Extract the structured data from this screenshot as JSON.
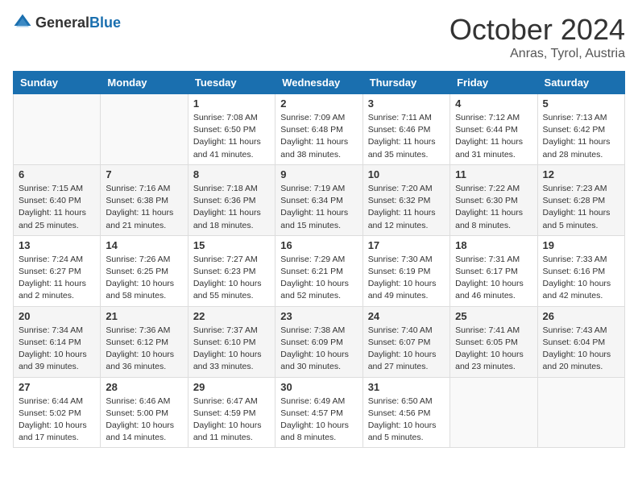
{
  "header": {
    "logo_general": "General",
    "logo_blue": "Blue",
    "month": "October 2024",
    "location": "Anras, Tyrol, Austria"
  },
  "days_of_week": [
    "Sunday",
    "Monday",
    "Tuesday",
    "Wednesday",
    "Thursday",
    "Friday",
    "Saturday"
  ],
  "weeks": [
    [
      {
        "day": "",
        "info": ""
      },
      {
        "day": "",
        "info": ""
      },
      {
        "day": "1",
        "info": "Sunrise: 7:08 AM\nSunset: 6:50 PM\nDaylight: 11 hours and 41 minutes."
      },
      {
        "day": "2",
        "info": "Sunrise: 7:09 AM\nSunset: 6:48 PM\nDaylight: 11 hours and 38 minutes."
      },
      {
        "day": "3",
        "info": "Sunrise: 7:11 AM\nSunset: 6:46 PM\nDaylight: 11 hours and 35 minutes."
      },
      {
        "day": "4",
        "info": "Sunrise: 7:12 AM\nSunset: 6:44 PM\nDaylight: 11 hours and 31 minutes."
      },
      {
        "day": "5",
        "info": "Sunrise: 7:13 AM\nSunset: 6:42 PM\nDaylight: 11 hours and 28 minutes."
      }
    ],
    [
      {
        "day": "6",
        "info": "Sunrise: 7:15 AM\nSunset: 6:40 PM\nDaylight: 11 hours and 25 minutes."
      },
      {
        "day": "7",
        "info": "Sunrise: 7:16 AM\nSunset: 6:38 PM\nDaylight: 11 hours and 21 minutes."
      },
      {
        "day": "8",
        "info": "Sunrise: 7:18 AM\nSunset: 6:36 PM\nDaylight: 11 hours and 18 minutes."
      },
      {
        "day": "9",
        "info": "Sunrise: 7:19 AM\nSunset: 6:34 PM\nDaylight: 11 hours and 15 minutes."
      },
      {
        "day": "10",
        "info": "Sunrise: 7:20 AM\nSunset: 6:32 PM\nDaylight: 11 hours and 12 minutes."
      },
      {
        "day": "11",
        "info": "Sunrise: 7:22 AM\nSunset: 6:30 PM\nDaylight: 11 hours and 8 minutes."
      },
      {
        "day": "12",
        "info": "Sunrise: 7:23 AM\nSunset: 6:28 PM\nDaylight: 11 hours and 5 minutes."
      }
    ],
    [
      {
        "day": "13",
        "info": "Sunrise: 7:24 AM\nSunset: 6:27 PM\nDaylight: 11 hours and 2 minutes."
      },
      {
        "day": "14",
        "info": "Sunrise: 7:26 AM\nSunset: 6:25 PM\nDaylight: 10 hours and 58 minutes."
      },
      {
        "day": "15",
        "info": "Sunrise: 7:27 AM\nSunset: 6:23 PM\nDaylight: 10 hours and 55 minutes."
      },
      {
        "day": "16",
        "info": "Sunrise: 7:29 AM\nSunset: 6:21 PM\nDaylight: 10 hours and 52 minutes."
      },
      {
        "day": "17",
        "info": "Sunrise: 7:30 AM\nSunset: 6:19 PM\nDaylight: 10 hours and 49 minutes."
      },
      {
        "day": "18",
        "info": "Sunrise: 7:31 AM\nSunset: 6:17 PM\nDaylight: 10 hours and 46 minutes."
      },
      {
        "day": "19",
        "info": "Sunrise: 7:33 AM\nSunset: 6:16 PM\nDaylight: 10 hours and 42 minutes."
      }
    ],
    [
      {
        "day": "20",
        "info": "Sunrise: 7:34 AM\nSunset: 6:14 PM\nDaylight: 10 hours and 39 minutes."
      },
      {
        "day": "21",
        "info": "Sunrise: 7:36 AM\nSunset: 6:12 PM\nDaylight: 10 hours and 36 minutes."
      },
      {
        "day": "22",
        "info": "Sunrise: 7:37 AM\nSunset: 6:10 PM\nDaylight: 10 hours and 33 minutes."
      },
      {
        "day": "23",
        "info": "Sunrise: 7:38 AM\nSunset: 6:09 PM\nDaylight: 10 hours and 30 minutes."
      },
      {
        "day": "24",
        "info": "Sunrise: 7:40 AM\nSunset: 6:07 PM\nDaylight: 10 hours and 27 minutes."
      },
      {
        "day": "25",
        "info": "Sunrise: 7:41 AM\nSunset: 6:05 PM\nDaylight: 10 hours and 23 minutes."
      },
      {
        "day": "26",
        "info": "Sunrise: 7:43 AM\nSunset: 6:04 PM\nDaylight: 10 hours and 20 minutes."
      }
    ],
    [
      {
        "day": "27",
        "info": "Sunrise: 6:44 AM\nSunset: 5:02 PM\nDaylight: 10 hours and 17 minutes."
      },
      {
        "day": "28",
        "info": "Sunrise: 6:46 AM\nSunset: 5:00 PM\nDaylight: 10 hours and 14 minutes."
      },
      {
        "day": "29",
        "info": "Sunrise: 6:47 AM\nSunset: 4:59 PM\nDaylight: 10 hours and 11 minutes."
      },
      {
        "day": "30",
        "info": "Sunrise: 6:49 AM\nSunset: 4:57 PM\nDaylight: 10 hours and 8 minutes."
      },
      {
        "day": "31",
        "info": "Sunrise: 6:50 AM\nSunset: 4:56 PM\nDaylight: 10 hours and 5 minutes."
      },
      {
        "day": "",
        "info": ""
      },
      {
        "day": "",
        "info": ""
      }
    ]
  ]
}
